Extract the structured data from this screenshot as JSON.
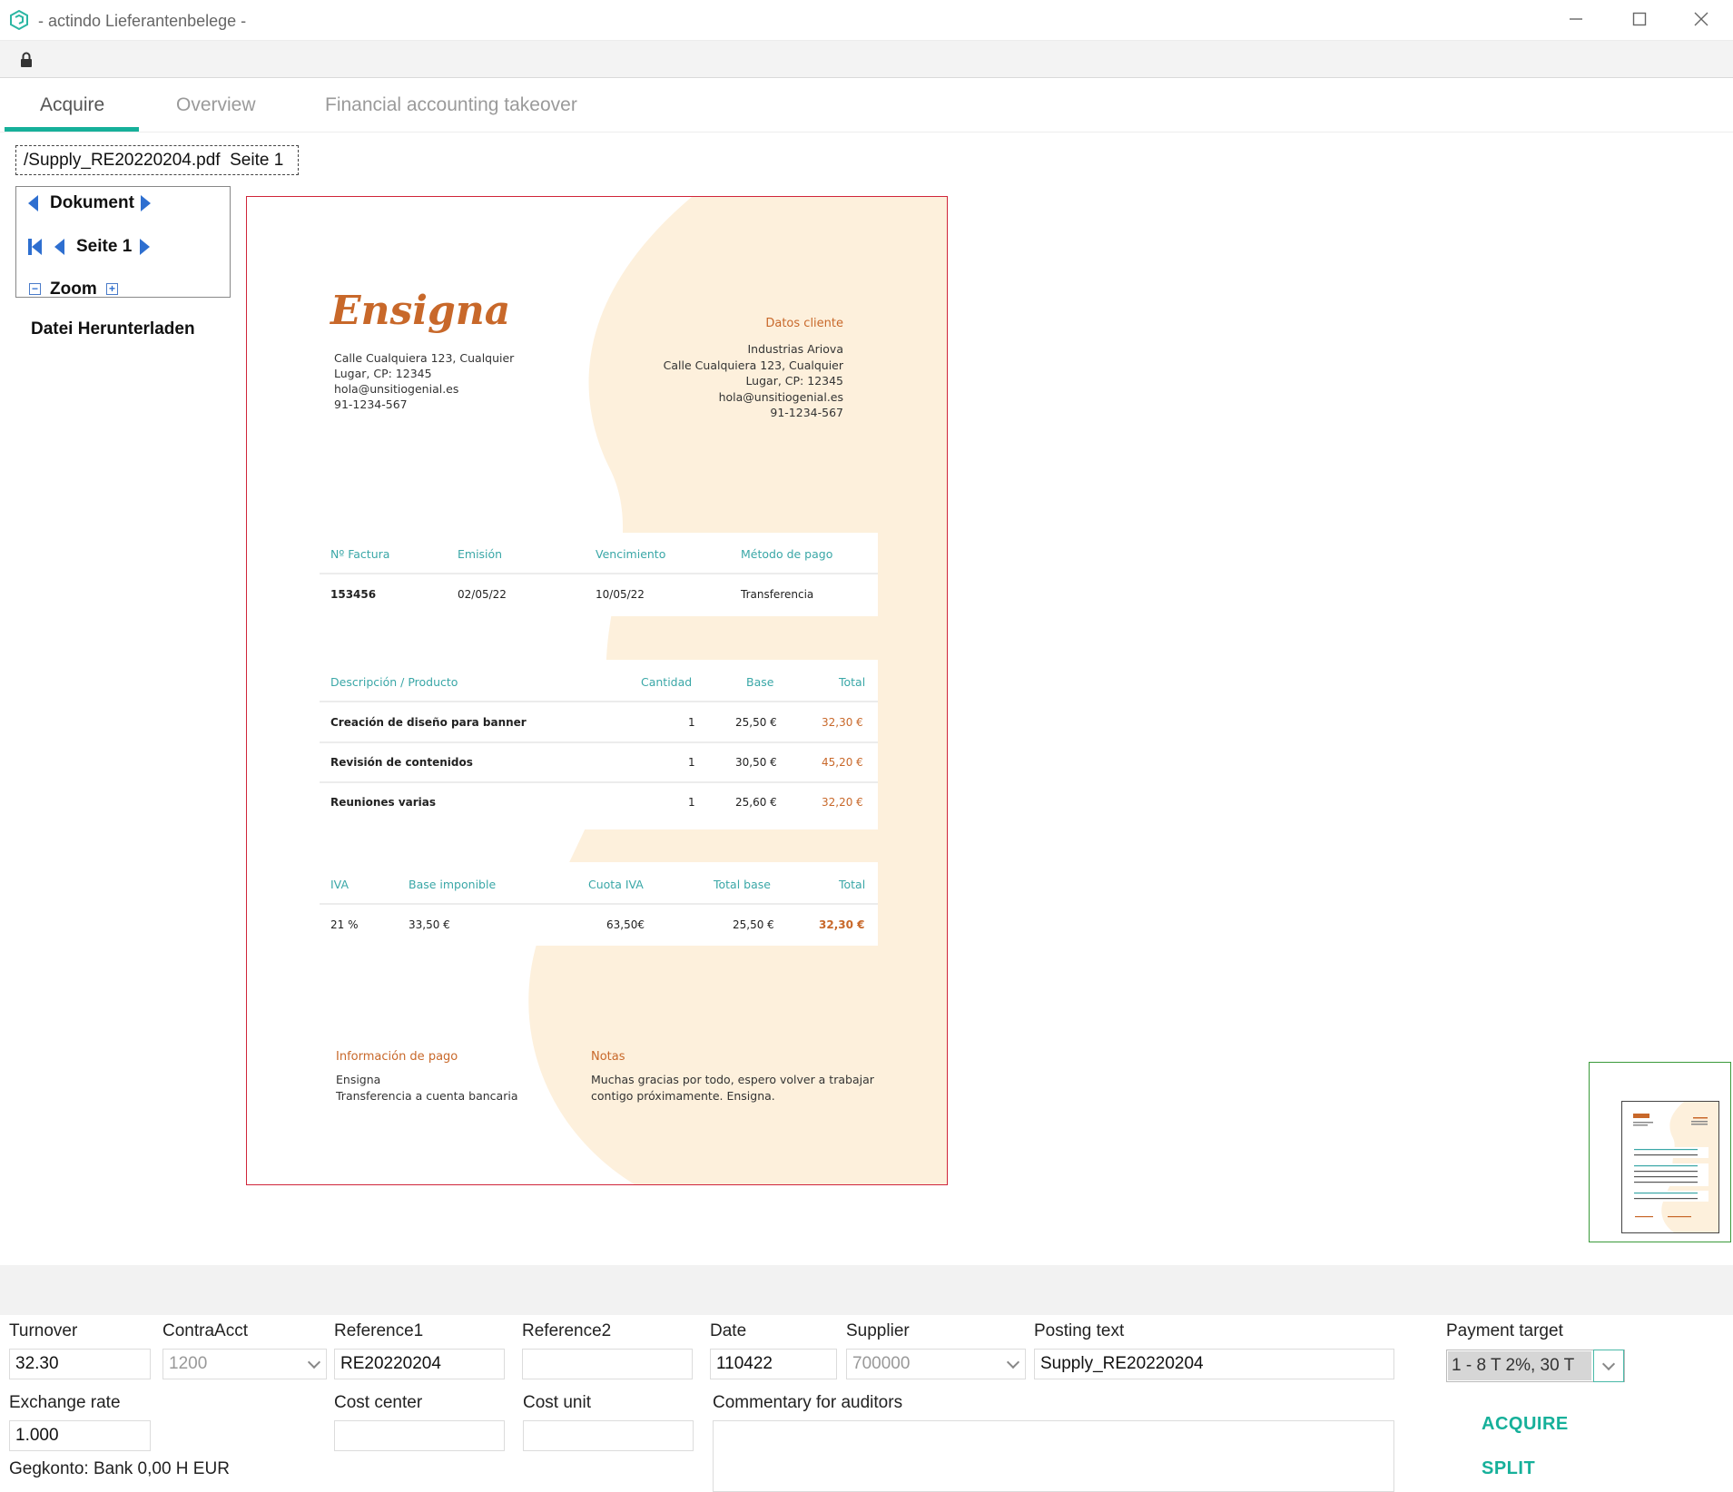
{
  "window": {
    "title": "- actindo Lieferantenbelege -",
    "controls": [
      "minimize",
      "maximize",
      "close"
    ]
  },
  "tabs": [
    {
      "label": "Acquire",
      "active": true
    },
    {
      "label": "Overview",
      "active": false
    },
    {
      "label": "Financial accounting takeover",
      "active": false
    }
  ],
  "viewer": {
    "filename": "/Supply_RE20220204.pdf  Seite 1",
    "document_label": "Dokument",
    "page_label": "Seite 1",
    "zoom_label": "Zoom",
    "download_label": "Datei Herunterladen"
  },
  "invoice": {
    "brand": "Ensigna",
    "sender_address": [
      "Calle Cualquiera 123, Cualquier",
      "Lugar, CP: 12345",
      "hola@unsitiogenial.es",
      "91-1234-567"
    ],
    "client_heading": "Datos cliente",
    "client_address": [
      "Industrias Ariova",
      "Calle Cualquiera 123, Cualquier",
      "Lugar, CP: 12345",
      "hola@unsitiogenial.es",
      "91-1234-567"
    ],
    "meta": {
      "headers": [
        "Nº Factura",
        "Emisión",
        "Vencimiento",
        "Método de pago"
      ],
      "values": [
        "153456",
        "02/05/22",
        "10/05/22",
        "Transferencia"
      ]
    },
    "items": {
      "headers": [
        "Descripción / Producto",
        "Cantidad",
        "Base",
        "Total"
      ],
      "rows": [
        [
          "Creación de diseño para banner",
          "1",
          "25,50 €",
          "32,30 €"
        ],
        [
          "Revisión de contenidos",
          "1",
          "30,50 €",
          "45,20 €"
        ],
        [
          "Reuniones varias",
          "1",
          "25,60 €",
          "32,20 €"
        ]
      ]
    },
    "tax": {
      "headers": [
        "IVA",
        "Base imponible",
        "Cuota IVA",
        "Total base",
        "Total"
      ],
      "values": [
        "21 %",
        "33,50 €",
        "63,50€",
        "25,50 €",
        "32,30 €"
      ]
    },
    "payment_heading": "Información de pago",
    "payment_lines": [
      "Ensigna",
      "Transferencia a cuenta bancaria"
    ],
    "notes_heading": "Notas",
    "notes_lines": [
      "Muchas gracias por todo, espero volver a trabajar",
      "contigo próximamente. Ensigna."
    ],
    "colors": {
      "accent": "#c8682a",
      "teal": "#3aa7a7",
      "shape": "#fdf0dc"
    }
  },
  "form": {
    "turnover": {
      "label": "Turnover",
      "value": "32.30"
    },
    "contra_acct": {
      "label": "ContraAcct",
      "value": "1200"
    },
    "reference1": {
      "label": "Reference1",
      "value": "RE20220204"
    },
    "reference2": {
      "label": "Reference2",
      "value": ""
    },
    "date": {
      "label": "Date",
      "value": "110422"
    },
    "supplier": {
      "label": "Supplier",
      "value": "700000"
    },
    "posting_text": {
      "label": "Posting text",
      "value": "Supply_RE20220204"
    },
    "payment_target": {
      "label": "Payment target",
      "value": "1 - 8 T 2%, 30 T"
    },
    "exchange_rate": {
      "label": "Exchange rate",
      "value": "1.000"
    },
    "cost_center": {
      "label": "Cost center",
      "value": ""
    },
    "cost_unit": {
      "label": "Cost unit",
      "value": ""
    },
    "commentary": {
      "label": "Commentary for auditors",
      "value": ""
    },
    "gegkonto": "Gegkonto: Bank 0,00 H EUR",
    "acquire_label": "ACQUIRE",
    "split_label": "SPLIT",
    "accent_color": "#16b09a"
  }
}
